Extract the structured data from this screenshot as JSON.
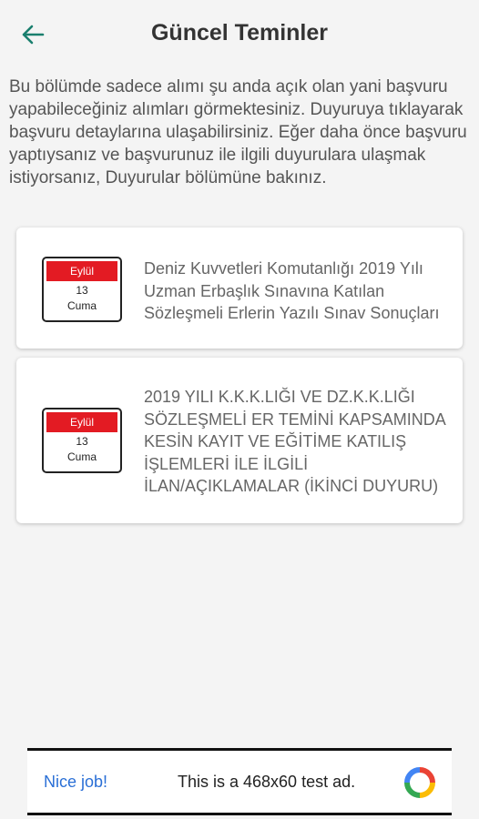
{
  "header": {
    "title": "Güncel Teminler",
    "back_icon": "arrow-left-icon",
    "accent_color": "#1a7f6e"
  },
  "intro": {
    "text": "Bu bölümde sadece alımı şu anda açık olan yani başvuru yapabileceğiniz alımları görmektesiniz. Duyuruya tıklayarak başvuru detaylarına ulaşabilirsiniz. Eğer daha önce başvuru yaptıysanız ve başvurunuz ile ilgili duyurulara ulaşmak istiyorsanız, Duyurular bölümüne bakınız."
  },
  "announcements": [
    {
      "month": "Eylül",
      "day": "13",
      "weekday": "Cuma",
      "title": "Deniz Kuvvetleri Komutanlığı 2019 Yılı Uzman Erbaşlık Sınavına Katılan Sözleşmeli Erlerin Yazılı Sınav Sonuçları"
    },
    {
      "month": "Eylül",
      "day": "13",
      "weekday": "Cuma",
      "title": "2019 YILI K.K.K.LIĞI VE DZ.K.K.LIĞI SÖZLEŞMELİ ER TEMİNİ KAPSAMINDA KESİN KAYIT VE EĞİTİME KATILIŞ İŞLEMLERİ  İLE İLGİLİ İLAN/AÇIKLAMALAR (İKİNCİ DUYURU)"
    }
  ],
  "ad": {
    "nice_label": "Nice job!",
    "text": "This is a 468x60 test ad.",
    "logo_icon": "adchoices-logo-icon"
  },
  "colors": {
    "calendar_red": "#e31b23",
    "ad_blue": "#2a6fd6",
    "background": "#f4f4f4"
  }
}
